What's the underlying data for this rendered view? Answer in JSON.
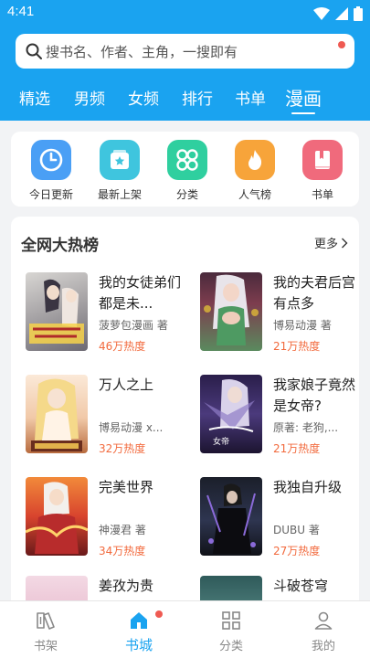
{
  "status": {
    "time": "4:41"
  },
  "search": {
    "placeholder": "搜书名、作者、主角，一搜即有"
  },
  "tabs": [
    {
      "label": "精选",
      "active": false
    },
    {
      "label": "男频",
      "active": false
    },
    {
      "label": "女频",
      "active": false
    },
    {
      "label": "排行",
      "active": false
    },
    {
      "label": "书单",
      "active": false
    },
    {
      "label": "漫画",
      "active": true
    }
  ],
  "categories": [
    {
      "label": "今日更新",
      "icon": "clock-icon",
      "color": "#4a9ff5"
    },
    {
      "label": "最新上架",
      "icon": "new-shelf-star-icon",
      "color": "#3fc5de"
    },
    {
      "label": "分类",
      "icon": "category-grid-icon",
      "color": "#2fcf9f"
    },
    {
      "label": "人气榜",
      "icon": "flame-icon",
      "color": "#f7a43a"
    },
    {
      "label": "书单",
      "icon": "booklist-icon",
      "color": "#f06a7c"
    }
  ],
  "ranking": {
    "title": "全网大热榜",
    "more_label": "更多",
    "books": [
      {
        "title": "我的女徒弟们都是未...",
        "author": "菠萝包漫画 著",
        "heat": "46万热度"
      },
      {
        "title": "我的夫君后宫有点多",
        "author": "博易动漫 著",
        "heat": "21万热度"
      },
      {
        "title": "万人之上",
        "author": "博易动漫 x...",
        "heat": "32万热度"
      },
      {
        "title": "我家娘子竟然是女帝?",
        "author": "原著: 老狗,...",
        "heat": "21万热度"
      },
      {
        "title": "完美世界",
        "author": "神漫君 著",
        "heat": "34万热度"
      },
      {
        "title": "我独自升级",
        "author": "DUBU 著",
        "heat": "27万热度"
      },
      {
        "title": "姜孜为贵",
        "author": "",
        "heat": ""
      },
      {
        "title": "斗破苍穹",
        "author": "",
        "heat": ""
      }
    ]
  },
  "bottom_nav": [
    {
      "label": "书架",
      "icon": "bookshelf-icon",
      "active": false
    },
    {
      "label": "书城",
      "icon": "bookstore-home-icon",
      "active": true
    },
    {
      "label": "分类",
      "icon": "category-icon",
      "active": false
    },
    {
      "label": "我的",
      "icon": "profile-icon",
      "active": false
    }
  ],
  "colors": {
    "brand": "#1aa3f0",
    "heat": "#f26a3d",
    "badge": "#ef5a52"
  }
}
